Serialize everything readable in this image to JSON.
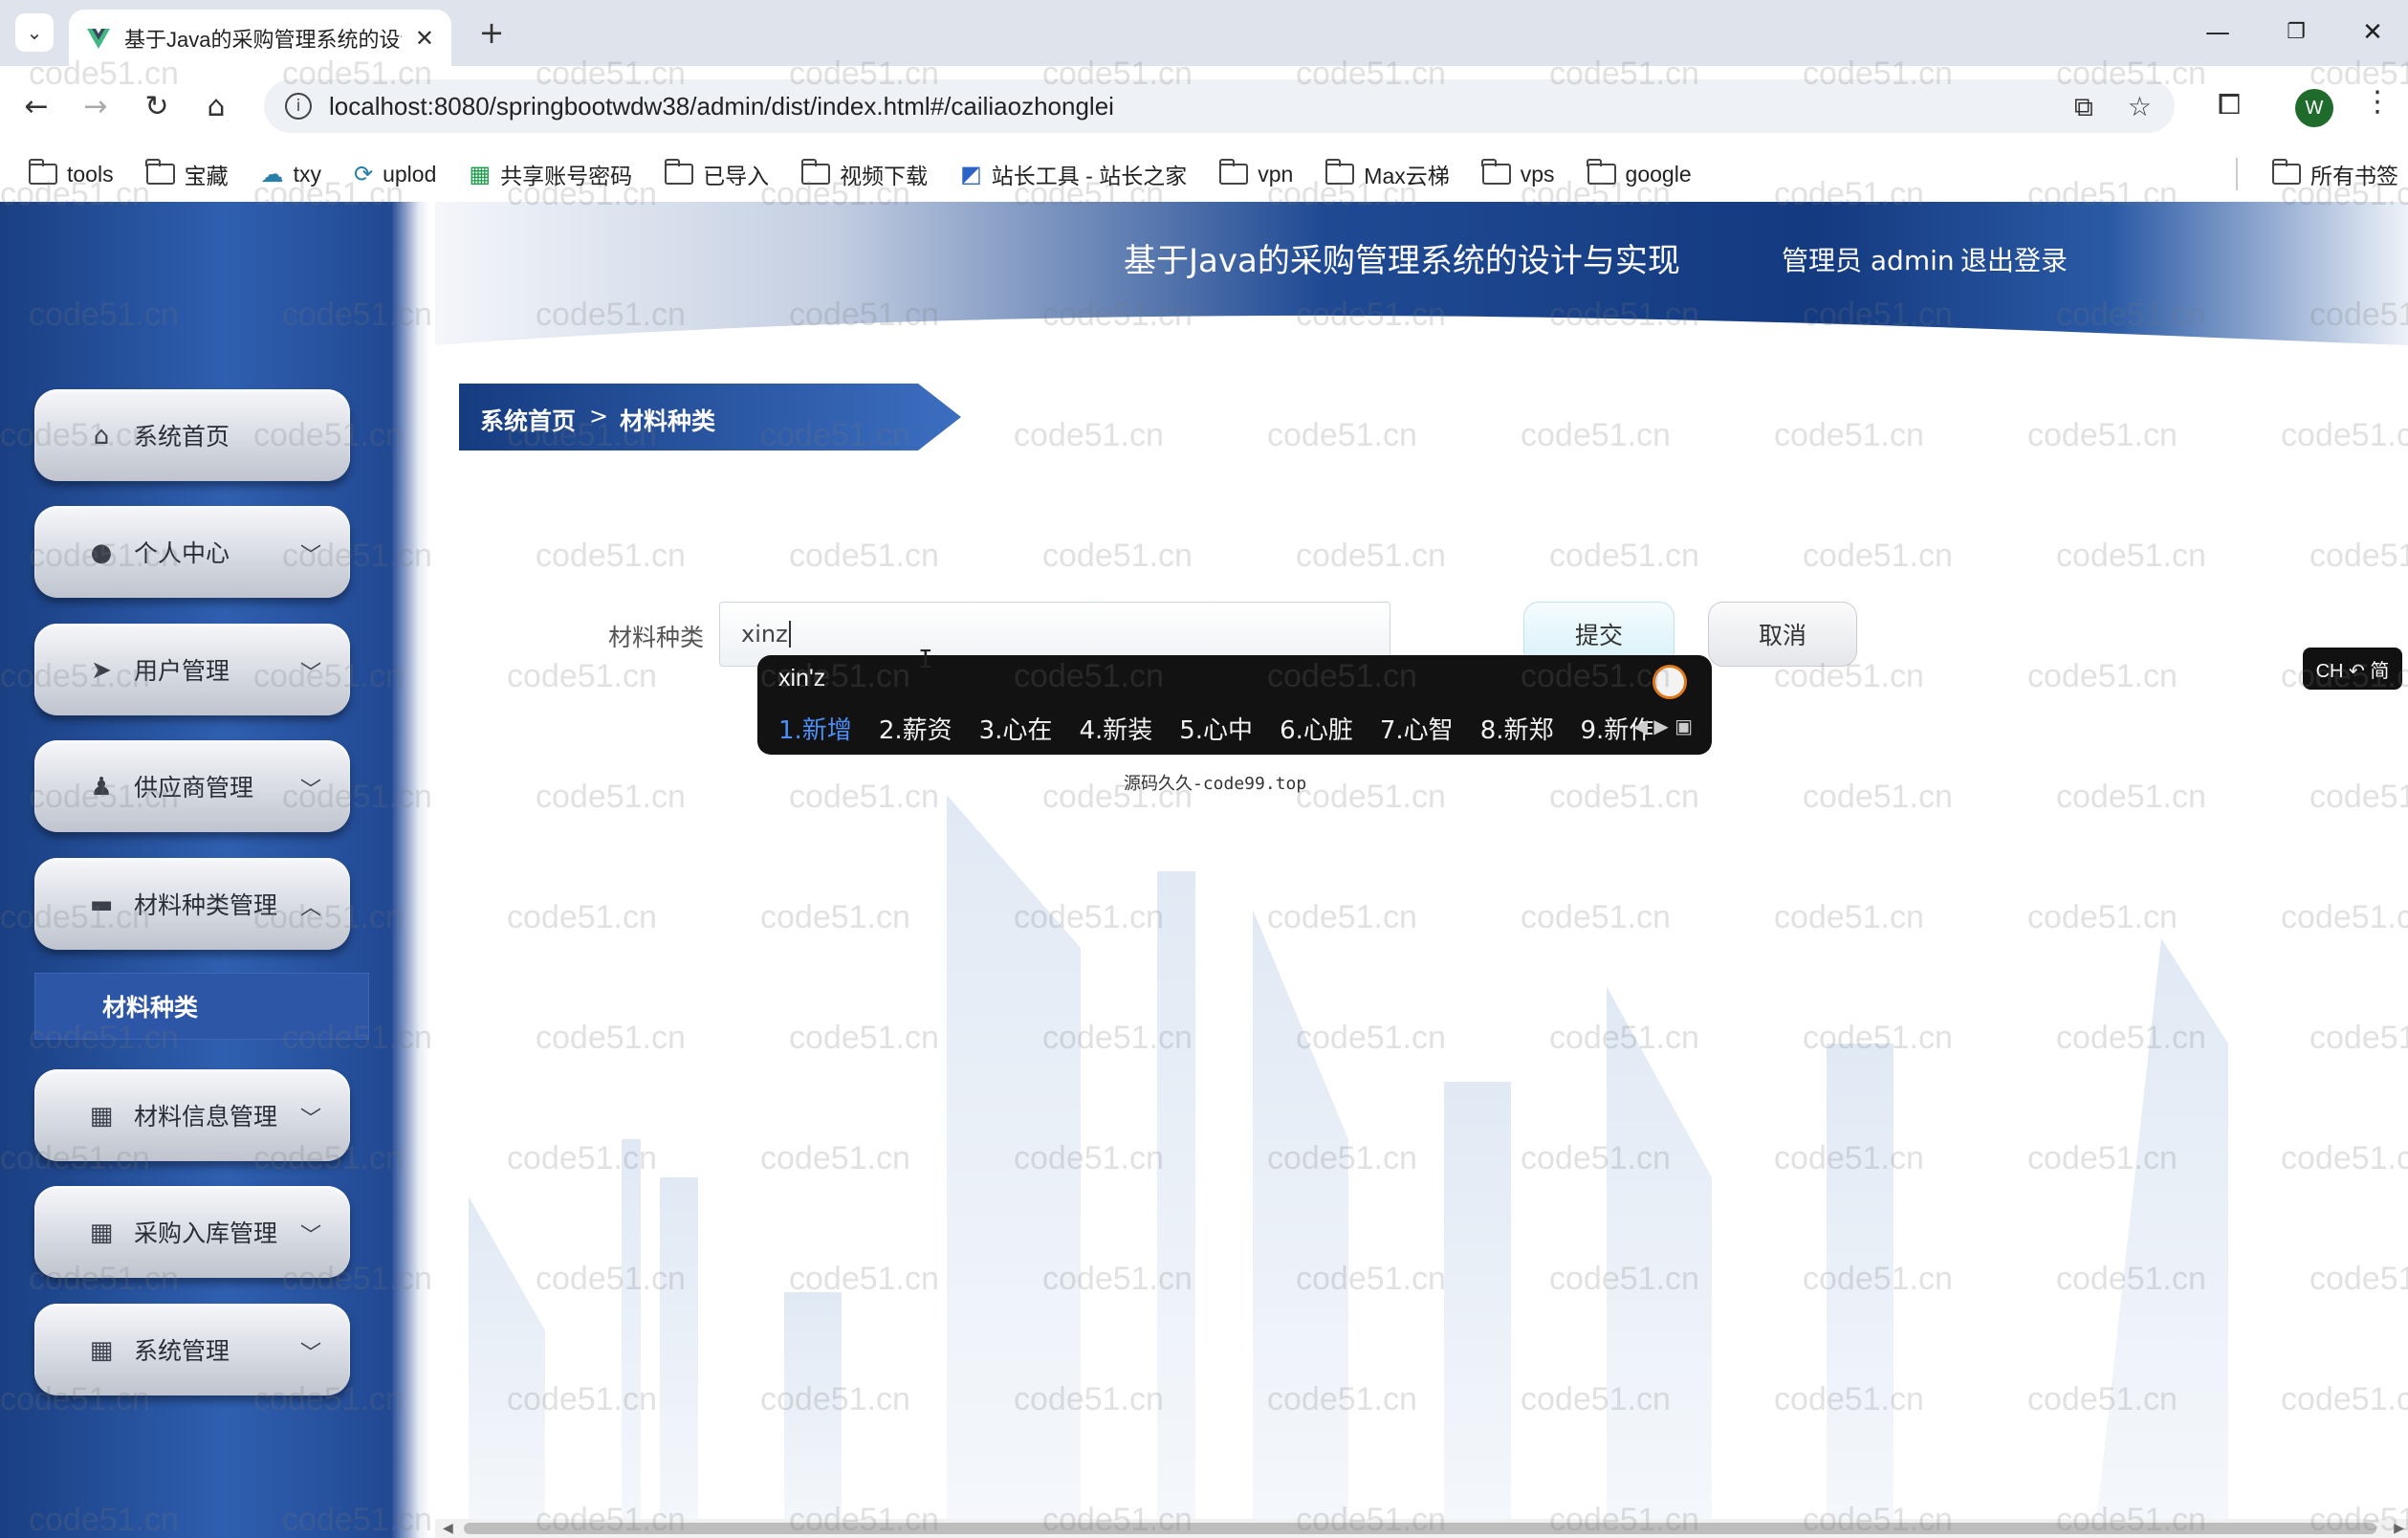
{
  "browser": {
    "tab_title": "基于Java的采购管理系统的设计",
    "url": "localhost:8080/springbootwdw38/admin/dist/index.html#/cailiaozhonglei",
    "profile_initial": "W",
    "bookmarks": [
      {
        "label": "tools",
        "icon": "folder-icon"
      },
      {
        "label": "宝藏",
        "icon": "folder-icon"
      },
      {
        "label": "txy",
        "icon": "cloud-icon"
      },
      {
        "label": "uplod",
        "icon": "upload-icon"
      },
      {
        "label": "共享账号密码",
        "icon": "sheet-icon"
      },
      {
        "label": "已导入",
        "icon": "folder-icon"
      },
      {
        "label": "视频下载",
        "icon": "folder-icon"
      },
      {
        "label": "站长工具 - 站长之家",
        "icon": "site-icon"
      },
      {
        "label": "vpn",
        "icon": "folder-icon"
      },
      {
        "label": "Max云梯",
        "icon": "folder-icon"
      },
      {
        "label": "vps",
        "icon": "folder-icon"
      },
      {
        "label": "google",
        "icon": "folder-icon"
      }
    ],
    "all_bookmarks": "所有书签"
  },
  "header": {
    "title": "基于Java的采购管理系统的设计与实现",
    "admin": "管理员 admin",
    "logout": "退出登录"
  },
  "sidebar": {
    "items": [
      {
        "label": "系统首页",
        "icon": "home-icon",
        "chevron": ""
      },
      {
        "label": "个人中心",
        "icon": "user-icon",
        "chevron": "﹀"
      },
      {
        "label": "用户管理",
        "icon": "send-icon",
        "chevron": "﹀"
      },
      {
        "label": "供应商管理",
        "icon": "person-icon",
        "chevron": "﹀"
      },
      {
        "label": "材料种类管理",
        "icon": "briefcase-icon",
        "chevron": "︿"
      },
      {
        "label": "材料信息管理",
        "icon": "grid-icon",
        "chevron": "﹀"
      },
      {
        "label": "采购入库管理",
        "icon": "grid-icon",
        "chevron": "﹀"
      },
      {
        "label": "系统管理",
        "icon": "grid-icon",
        "chevron": "﹀"
      }
    ],
    "submenu_label": "材料种类"
  },
  "breadcrumb": {
    "home": "系统首页",
    "separator": ">",
    "current": "材料种类"
  },
  "form": {
    "label": "材料种类",
    "value": "xinz",
    "submit": "提交",
    "cancel": "取消"
  },
  "ime": {
    "composition": "xin'z",
    "candidates": [
      "1.新增",
      "2.薪资",
      "3.心在",
      "4.新装",
      "5.心中",
      "6.心脏",
      "7.心智",
      "8.新郑",
      "9.新作"
    ],
    "footer": "源码久久-code99.top",
    "status": "CH ↶ 简"
  },
  "watermark": "code51.cn"
}
